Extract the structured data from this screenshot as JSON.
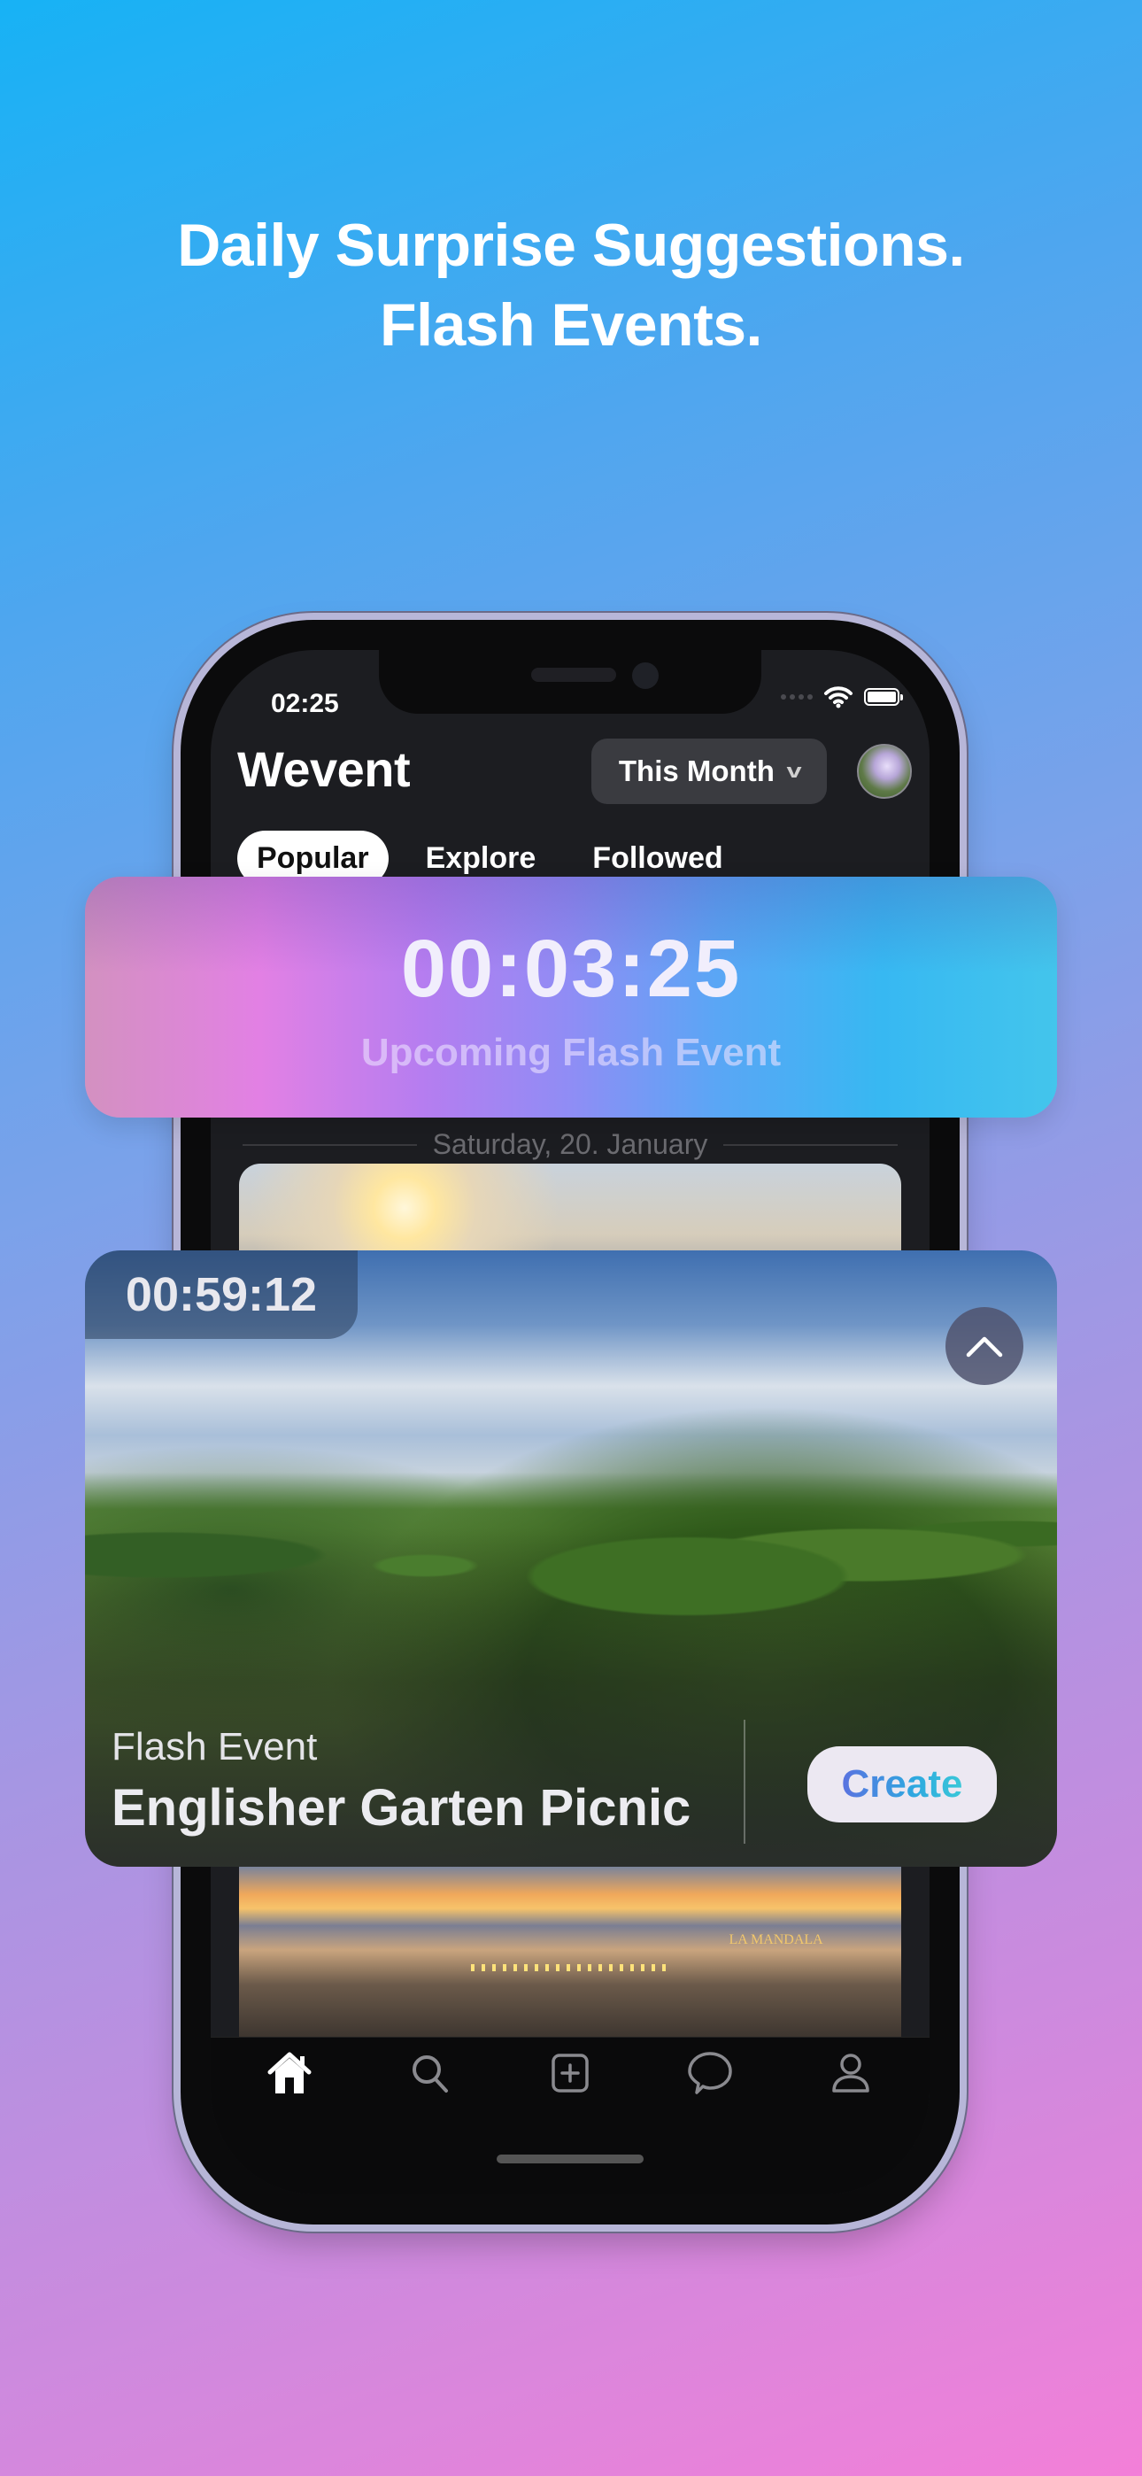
{
  "headline": {
    "line1": "Daily Surprise Suggestions.",
    "line2": "Flash Events."
  },
  "status_bar": {
    "time": "02:25",
    "icons": [
      "signal-dots-icon",
      "wifi-icon",
      "battery-icon"
    ]
  },
  "header": {
    "app_title": "Wevent",
    "range_selector": {
      "selected": "This Month",
      "icon": "chevron-down-icon"
    },
    "avatar": "profile-avatar"
  },
  "tabs": [
    {
      "label": "Popular",
      "active": true
    },
    {
      "label": "Explore",
      "active": false
    },
    {
      "label": "Followed",
      "active": false
    }
  ],
  "feed": {
    "date_separator": "Saturday, 20. January"
  },
  "flash_banner": {
    "countdown": "00:03:25",
    "caption": "Upcoming Flash Event",
    "colors": {
      "start": "#e280e4",
      "end": "#37b8f2"
    }
  },
  "event_card": {
    "timer": "00:59:12",
    "collapse_icon": "chevron-up-icon",
    "kicker": "Flash Event",
    "title": "Englisher Garten Picnic",
    "create_label": "Create"
  },
  "feed_image2_sign": "LA MANDALA",
  "tab_bar": {
    "items": [
      {
        "name": "home",
        "icon": "home-icon",
        "active": true
      },
      {
        "name": "search",
        "icon": "search-icon",
        "active": false
      },
      {
        "name": "create",
        "icon": "plus-square-icon",
        "active": false
      },
      {
        "name": "messages",
        "icon": "chat-bubble-icon",
        "active": false
      },
      {
        "name": "profile",
        "icon": "person-icon",
        "active": false
      }
    ]
  }
}
